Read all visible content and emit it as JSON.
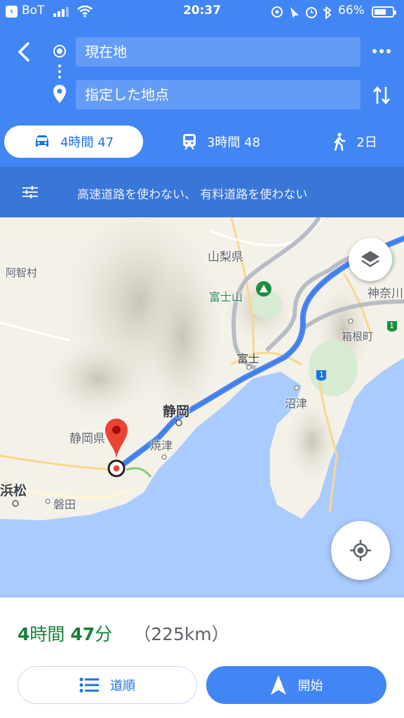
{
  "status_bar": {
    "carrier": "BoT",
    "time": "20:37",
    "battery_text": "66%",
    "battery_level": 0.66
  },
  "directions": {
    "from_label": "現在地",
    "to_label": "指定した地点"
  },
  "modes": [
    {
      "icon": "car-icon",
      "label": "4時間 47",
      "selected": true
    },
    {
      "icon": "train-icon",
      "label": "3時間 48",
      "selected": false
    },
    {
      "icon": "walk-icon",
      "label": "2日",
      "selected": false
    }
  ],
  "route_options": "高速道路を使わない、 有料道路を使わない",
  "map": {
    "labels": {
      "yamanashi": "山梨県",
      "kanagawa": "神奈川",
      "fujisan": "富士山",
      "achi": "阿智村",
      "hakone": "箱根町",
      "fuji": "富士",
      "numazu": "沼津",
      "shizuoka_city": "静岡",
      "shizuoka_pref": "静岡県",
      "yaizu": "焼津",
      "hamamatsu": "浜松",
      "iwata": "磐田",
      "route_1_a": "1",
      "route_1_b": "1"
    }
  },
  "summary": {
    "duration_h": "4",
    "duration_h_unit": "時間",
    "duration_m": "47",
    "duration_m_unit": "分",
    "distance": "（225km）"
  },
  "buttons": {
    "steps": "道順",
    "start": "開始"
  },
  "colors": {
    "accent": "#4285f4",
    "route": "#4a86f0",
    "pin": "#ea4335",
    "duration": "#188038"
  }
}
